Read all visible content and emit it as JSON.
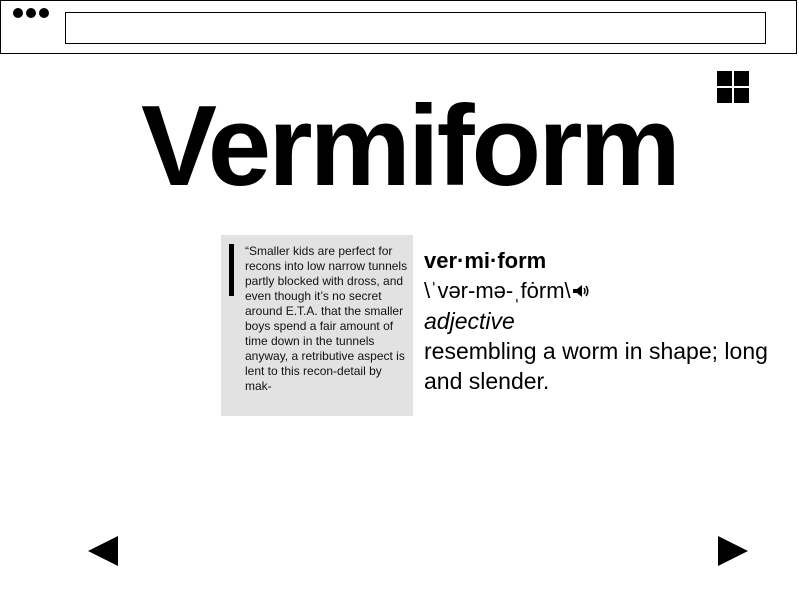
{
  "window": {
    "controls_icon": "three-dots-icon",
    "address_bar_value": ""
  },
  "toolbar": {
    "grid_icon": "grid-icon"
  },
  "word": {
    "title": "Vermiform"
  },
  "quote": {
    "text": "“Smaller kids are perfect for recons into low narrow tunnels partly blocked with dross, and even though it’s no secret around E.T.A. that the smaller boys spend a fair amount of time down in the tunnels anyway, a retributive aspect is lent to this recon-detail by mak-"
  },
  "definition": {
    "headword": "ver·mi·form",
    "pronunciation": "\\ˈvər-mə-ˌfȯrm\\",
    "pronunciation_icon": "speaker-icon",
    "part_of_speech": "adjective",
    "meaning": "resembling a worm in shape; long and slender."
  },
  "navigation": {
    "prev_icon": "arrow-left-icon",
    "next_icon": "arrow-right-icon"
  }
}
